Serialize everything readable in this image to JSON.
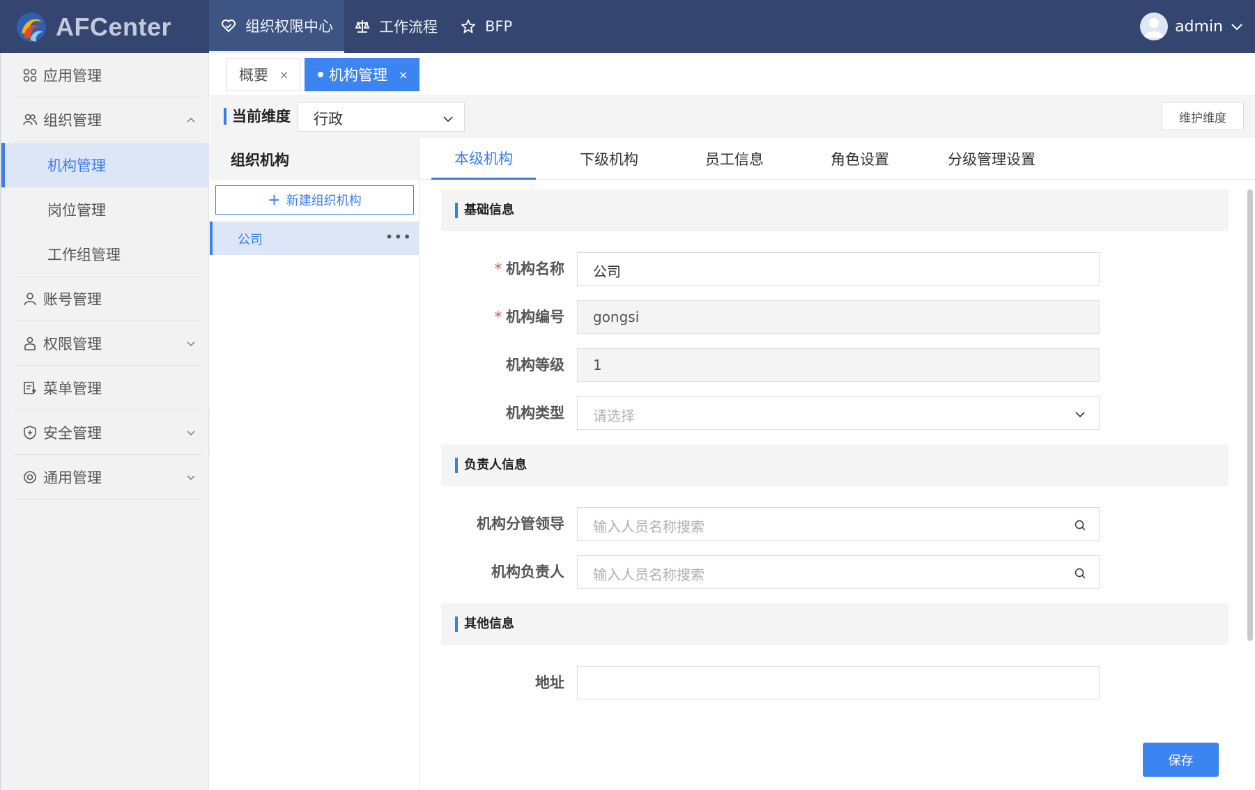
{
  "brand": "AFCenter",
  "topnav": [
    {
      "label": "组织权限中心",
      "icon": "heart-icon"
    },
    {
      "label": "工作流程",
      "icon": "scale-icon"
    },
    {
      "label": "BFP",
      "icon": "star-icon"
    }
  ],
  "user": {
    "name": "admin"
  },
  "sidebar": {
    "items": [
      {
        "label": "应用管理"
      },
      {
        "label": "组织管理"
      },
      {
        "label": "机构管理"
      },
      {
        "label": "岗位管理"
      },
      {
        "label": "工作组管理"
      },
      {
        "label": "账号管理"
      },
      {
        "label": "权限管理"
      },
      {
        "label": "菜单管理"
      },
      {
        "label": "安全管理"
      },
      {
        "label": "通用管理"
      }
    ]
  },
  "pagetabs": [
    {
      "label": "概要",
      "close": "×"
    },
    {
      "label": "机构管理",
      "close": "×"
    }
  ],
  "dimension": {
    "label": "当前维度",
    "value": "行政",
    "maintain": "维护维度"
  },
  "org": {
    "title": "组织机构",
    "new_button": "新建组织机构",
    "plus": "+",
    "items": [
      {
        "label": "公司",
        "more": "•••"
      }
    ]
  },
  "content_tabs": [
    "本级机构",
    "下级机构",
    "员工信息",
    "角色设置",
    "分级管理设置"
  ],
  "form": {
    "section_basic": "基础信息",
    "section_leader": "负责人信息",
    "section_other": "其他信息",
    "required_mark": "*",
    "name_label": "机构名称",
    "name_value": "公司",
    "code_label": "机构编号",
    "code_value": "gongsi",
    "level_label": "机构等级",
    "level_value": "1",
    "type_label": "机构类型",
    "type_placeholder": "请选择",
    "supervisor_label": "机构分管领导",
    "supervisor_placeholder": "输入人员名称搜索",
    "manager_label": "机构负责人",
    "manager_placeholder": "输入人员名称搜索",
    "address_label": "地址",
    "address_value": ""
  },
  "save_label": "保存"
}
